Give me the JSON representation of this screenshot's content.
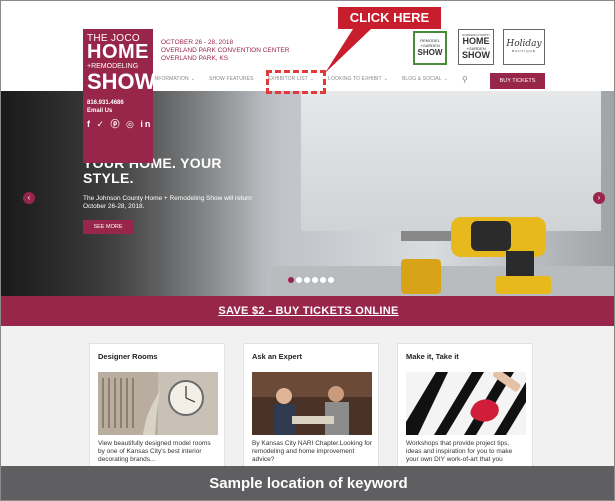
{
  "logo": {
    "line1": "THE JOCO",
    "line2": "HOME",
    "line3": "+REMODELING",
    "line4": "SHOW",
    "phone": "816.931.4686",
    "email_link": "Email Us",
    "social_icons": [
      "facebook-icon",
      "twitter-icon",
      "pinterest-icon",
      "instagram-icon",
      "linkedin-icon"
    ],
    "social_glyphs": "f ✓ ⓟ ◎ in"
  },
  "event": {
    "dates": "OCTOBER 26 - 28, 2018",
    "venue": "OVERLAND PARK CONVENTION CENTER",
    "city": "OVERLAND PARK, KS"
  },
  "partner_ads": {
    "remodel": {
      "small": "REMODEL",
      "small2": "+GARDEN",
      "big": "SHOW"
    },
    "joco": {
      "tiny": "JOHNSON COUNTY",
      "big1": "HOME",
      "small": "+GARDEN",
      "big2": "SHOW"
    },
    "holiday": {
      "script": "Holiday",
      "small": "BOUTIQUE"
    }
  },
  "nav": {
    "items": [
      {
        "label": "INFORMATION",
        "has_dropdown": true
      },
      {
        "label": "SHOW FEATURES",
        "has_dropdown": false
      },
      {
        "label": "EXHIBITOR LIST",
        "has_dropdown": true
      },
      {
        "label": "LOOKING TO EXHIBIT",
        "has_dropdown": true
      },
      {
        "label": "BLOG & SOCIAL",
        "has_dropdown": true
      }
    ],
    "buy_label": "BUY TICKETS",
    "chevron": "⌄",
    "search_glyph": "⚲"
  },
  "annotation": {
    "callout": "CLICK HERE",
    "color": "#c81d2c"
  },
  "hero": {
    "title": "YOUR HOME. YOUR STYLE.",
    "subtitle": "The Johnson County Home + Remodeling Show will return October 26-28, 2018.",
    "cta": "SEE MORE",
    "slide_count": 6,
    "active_slide": 1,
    "left_arrow": "‹",
    "right_arrow": "›"
  },
  "promo": {
    "label": "SAVE $2 - BUY TICKETS ONLINE"
  },
  "cards": [
    {
      "title": "Designer Rooms",
      "text": "View beautifully designed model rooms by one of Kansas City's best interior decorating brands..."
    },
    {
      "title": "Ask an Expert",
      "text": "By Kansas City NARI Chapter.Looking for remodeling and home improvement advice?"
    },
    {
      "title": "Make it, Take it",
      "text": "Workshops that provide project tips, ideas and inspiration for you to make your own DIY work-of-art that you"
    }
  ],
  "caption": "Sample location of keyword",
  "colors": {
    "brand": "#98264a",
    "callout": "#c81d2c",
    "caption_bg": "#5f5f61"
  }
}
